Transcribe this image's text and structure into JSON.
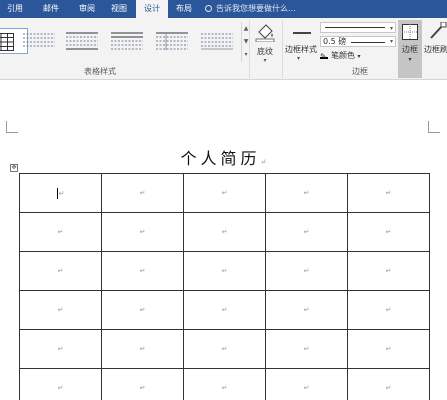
{
  "ribbon_tabs": [
    {
      "label": "引用",
      "active": false
    },
    {
      "label": "邮件",
      "active": false
    },
    {
      "label": "审阅",
      "active": false
    },
    {
      "label": "视图",
      "active": false
    },
    {
      "label": "设计",
      "active": true
    },
    {
      "label": "布局",
      "active": false
    }
  ],
  "tell_me": "告诉我您想要做什么...",
  "groups": {
    "table_styles_label": "表格样式",
    "borders_label": "边框"
  },
  "buttons": {
    "shading": "底纹",
    "border_styles": "边框样式",
    "line_weight": "0.5 磅",
    "pen_color": "笔颜色",
    "borders": "边框",
    "border_painter": "边框刷"
  },
  "gallery_scroll": [
    "▲",
    "▼",
    "▾"
  ],
  "dropdown_caret": "▾",
  "document": {
    "title": "个人简历",
    "para_mark": "↵",
    "move_handle": "✥",
    "table": {
      "rows": 6,
      "cols": 5,
      "cell_mark": "↵"
    }
  },
  "colors": {
    "ribbon_blue": "#2b579a",
    "ribbon_bg": "#f3f3f3",
    "table_border": "#333333"
  }
}
